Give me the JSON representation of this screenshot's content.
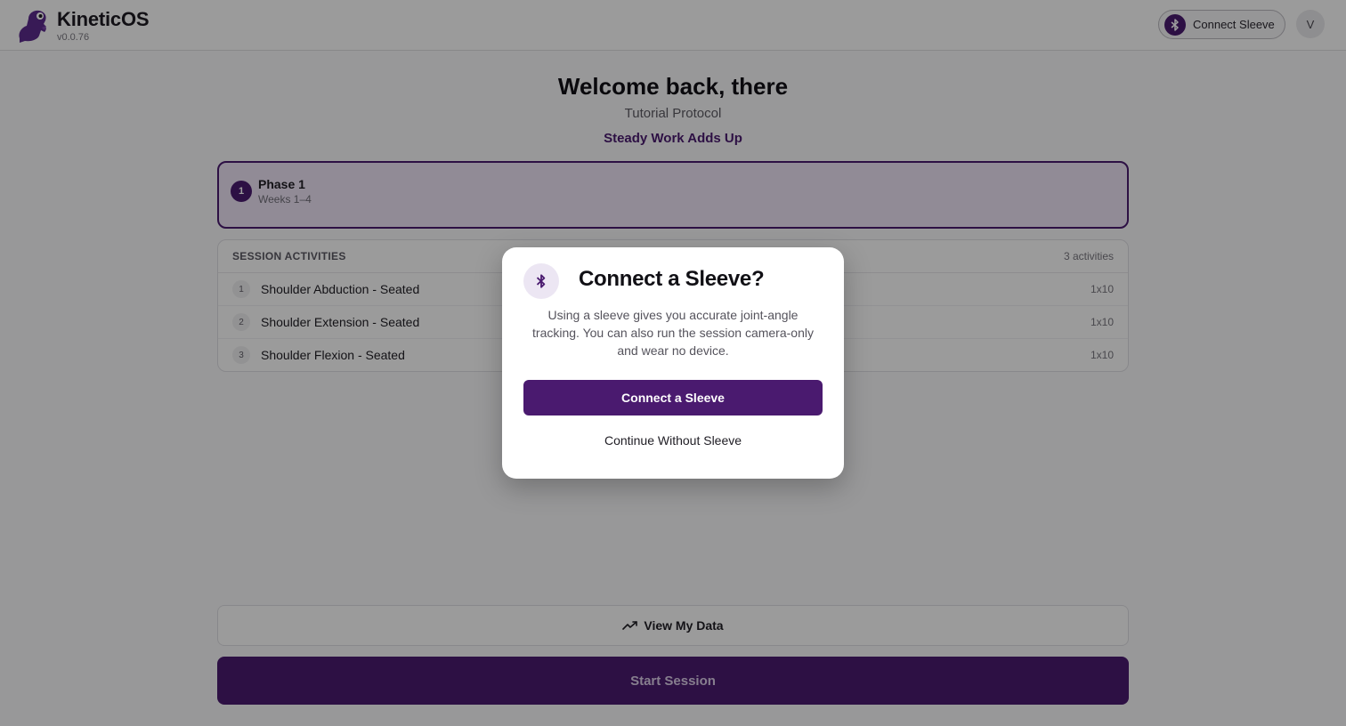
{
  "header": {
    "app_name": "KineticOS",
    "version": "v0.0.76",
    "connect_label": "Connect Sleeve",
    "avatar_initial": "V"
  },
  "main": {
    "welcome": "Welcome back, there",
    "protocol": "Tutorial Protocol",
    "motto": "Steady Work Adds Up",
    "phase": {
      "number": "1",
      "title": "Phase 1",
      "weeks": "Weeks 1–4"
    },
    "activities": {
      "title": "SESSION ACTIVITIES",
      "count": "3 activities",
      "items": [
        {
          "index": "1",
          "name": "Shoulder Abduction - Seated",
          "reps": "1x10"
        },
        {
          "index": "2",
          "name": "Shoulder Extension - Seated",
          "reps": "1x10"
        },
        {
          "index": "3",
          "name": "Shoulder Flexion - Seated",
          "reps": "1x10"
        }
      ]
    },
    "view_data_label": "View My Data",
    "start_session_label": "Start Session"
  },
  "modal": {
    "title": "Connect a Sleeve?",
    "body": "Using a sleeve gives you accurate joint-angle tracking. You can also run the session camera-only and wear no device.",
    "primary_label": "Connect a Sleeve",
    "secondary_label": "Continue Without Sleeve"
  },
  "colors": {
    "brand": "#4a1a6f",
    "brand_tint": "#eae1f3",
    "overlay": "rgba(0,0,0,0.38)"
  },
  "icons": {
    "logo": "dinosaur-logo-icon",
    "connect": "bluetooth-icon",
    "view_data": "trending-up-icon"
  }
}
